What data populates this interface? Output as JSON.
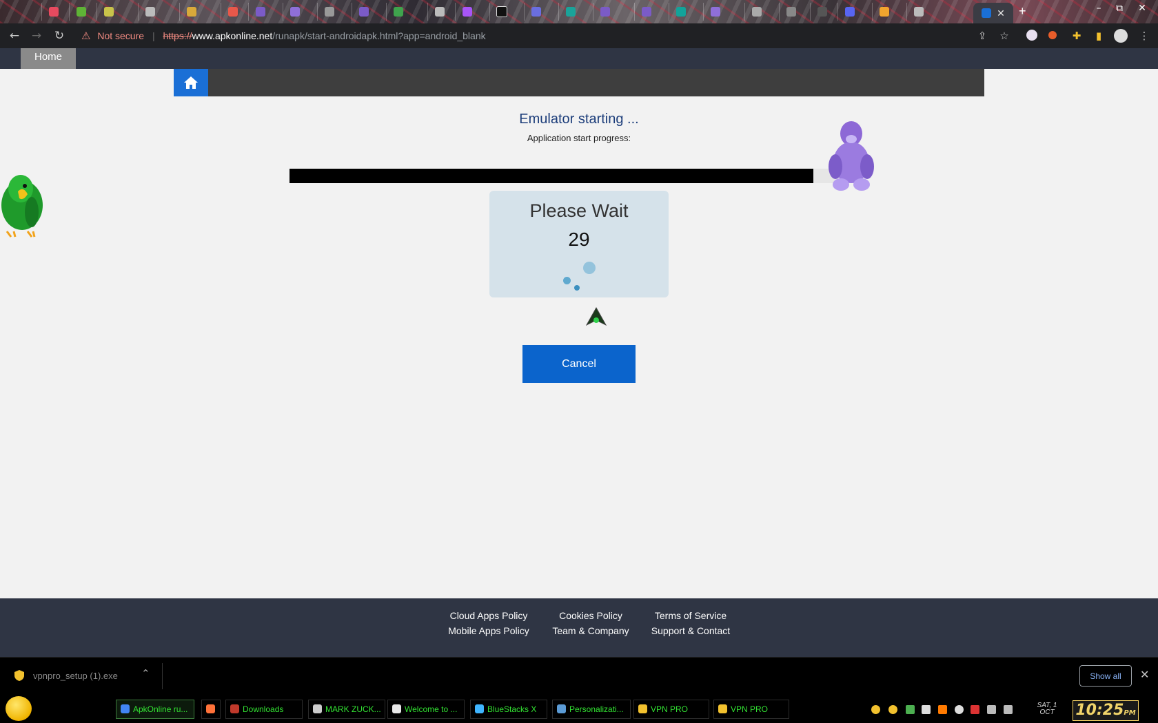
{
  "browser": {
    "security_label": "Not secure",
    "url_scheme": "https://",
    "url_domain": "www.apkonline.net",
    "url_path": "/runapk/start-androidapk.html?app=android_blank",
    "window_controls": {
      "minimize": "–",
      "restore": "⧉",
      "close": "✕"
    }
  },
  "site_nav": {
    "home_label": "Home"
  },
  "emulator": {
    "title": "Emulator starting ...",
    "progress_label": "Application start progress:",
    "progress_fraction": 0.95
  },
  "wait_box": {
    "title": "Please Wait",
    "countdown": "29"
  },
  "cancel_label": "Cancel",
  "footer": {
    "links": [
      "Cloud Apps Policy",
      "Cookies Policy",
      "Terms of Service",
      "Mobile Apps Policy",
      "Team & Company",
      "Support & Contact"
    ]
  },
  "download_bar": {
    "file_name": "vpnpro_setup (1).exe",
    "show_all_label": "Show all"
  },
  "taskbar": {
    "tasks": [
      {
        "label": "ApkOnline ru...",
        "icon": "chrome-icon",
        "color": "#4285f4"
      },
      {
        "label": "",
        "icon": "firefox-icon",
        "color": "#ff7139"
      },
      {
        "label": "Downloads",
        "icon": "downloads-folder-icon",
        "color": "#c0392b"
      },
      {
        "label": "MARK ZUCK...",
        "icon": "document-icon",
        "color": "#cccccc"
      },
      {
        "label": "Welcome to ...",
        "icon": "star-icon",
        "color": "#e8e8e8"
      },
      {
        "label": "BlueStacks X",
        "icon": "bluestacks-icon",
        "color": "#3fb5ff"
      },
      {
        "label": "Personalizati...",
        "icon": "monitor-icon",
        "color": "#5b9bd5"
      },
      {
        "label": "VPN PRO",
        "icon": "vpn-icon",
        "color": "#f2c12e"
      },
      {
        "label": "VPN PRO",
        "icon": "vpn-icon",
        "color": "#f2c12e"
      }
    ],
    "date_line1": "SAT, 1",
    "date_line2": "OCT",
    "clock": "10:25",
    "clock_suffix": "PM"
  },
  "colors": {
    "accent_blue": "#0b64cc",
    "nav_dark": "#2f3544",
    "wait_box": "#d5e2ea",
    "title_blue": "#1c3d7a"
  }
}
